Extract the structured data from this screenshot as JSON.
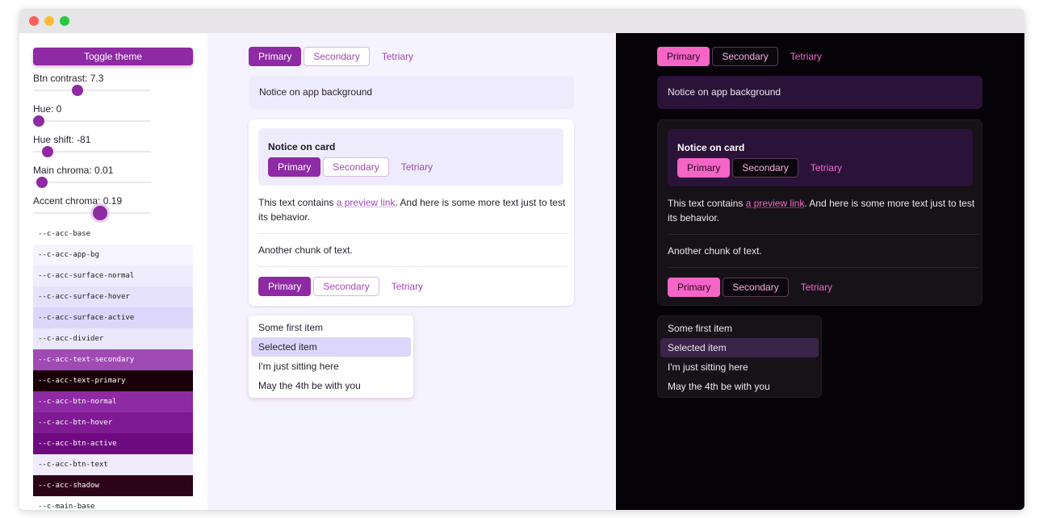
{
  "window": {
    "buttons": [
      "#ff5f57",
      "#febc2e",
      "#28c840"
    ]
  },
  "sidebar": {
    "toggle_label": "Toggle theme",
    "sliders": [
      {
        "label": "Btn contrast: 7.3",
        "level": 0.36
      },
      {
        "label": "Hue: 0",
        "level": 0.0
      },
      {
        "label": "Hue shift: -81",
        "level": 0.08
      },
      {
        "label": "Main chroma: 0.01",
        "level": 0.03
      },
      {
        "label": "Accent chroma: 0.19",
        "level": 0.58
      }
    ],
    "tokens": [
      {
        "name": "--c-acc-base",
        "bg": "#ffffff",
        "fg": "#1d1a22"
      },
      {
        "name": "--c-acc-app-bg",
        "bg": "#f6f4fe",
        "fg": "#1d1a22"
      },
      {
        "name": "--c-acc-surface-normal",
        "bg": "#efecfd",
        "fg": "#1d1a22"
      },
      {
        "name": "--c-acc-surface-hover",
        "bg": "#e6e2fc",
        "fg": "#1d1a22"
      },
      {
        "name": "--c-acc-surface-active",
        "bg": "#dcd7fa",
        "fg": "#1d1a22"
      },
      {
        "name": "--c-acc-divider",
        "bg": "#ebe7fc",
        "fg": "#1d1a22"
      },
      {
        "name": "--c-acc-text-secondary",
        "bg": "#a04bb3",
        "fg": "#ffffff"
      },
      {
        "name": "--c-acc-text-primary",
        "bg": "#1a0008",
        "fg": "#ffffff"
      },
      {
        "name": "--c-acc-btn-normal",
        "bg": "#8e2aa3",
        "fg": "#ffffff"
      },
      {
        "name": "--c-acc-btn-hover",
        "bg": "#801a93",
        "fg": "#ffffff"
      },
      {
        "name": "--c-acc-btn-active",
        "bg": "#6e0a7f",
        "fg": "#ffffff"
      },
      {
        "name": "--c-acc-btn-text",
        "bg": "#f0ecfd",
        "fg": "#1d1a22"
      },
      {
        "name": "--c-acc-shadow",
        "bg": "#2c0418",
        "fg": "#ffffff"
      },
      {
        "name": "--c-main-base",
        "bg": "#ffffff",
        "fg": "#1d1a22"
      }
    ]
  },
  "preview": {
    "top_buttons": {
      "primary": "Primary",
      "secondary": "Secondary",
      "tertiary": "Tetriary"
    },
    "notice_app": "Notice on app background",
    "card": {
      "notice_title": "Notice on card",
      "notice_buttons": {
        "primary": "Primary",
        "secondary": "Secondary",
        "tertiary": "Tetriary"
      },
      "text_before": "This text contains ",
      "link": "a preview link",
      "text_after": ". And here is some more text just to test its behavior.",
      "chunk": "Another chunk of text.",
      "bottom_buttons": {
        "primary": "Primary",
        "secondary": "Secondary",
        "tertiary": "Tetriary"
      }
    },
    "menu": {
      "items": [
        "Some first item",
        "Selected item",
        "I'm just sitting here",
        "May the 4th be with you"
      ],
      "selected_index": 1
    }
  }
}
